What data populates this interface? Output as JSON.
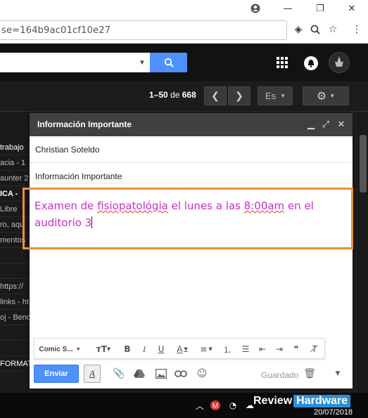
{
  "browser": {
    "url_fragment": "se=164b9ac01cf10e27"
  },
  "toolbar": {
    "page_range": "1–50",
    "page_of": "de",
    "page_total": "668",
    "lang_label": "Es"
  },
  "message_list": [
    {
      "text": "trabajo",
      "style": "bright"
    },
    {
      "text": "acia - 1",
      "style": "normal"
    },
    {
      "text": "aunter 2",
      "style": "normal"
    },
    {
      "text": "ICA - ",
      "style": "bold"
    },
    {
      "text": "Libre",
      "style": "normal"
    },
    {
      "text": "ro, aqu",
      "style": "normal"
    },
    {
      "text": "mentos",
      "style": "normal"
    },
    {
      "text": "",
      "style": "normal"
    },
    {
      "text": "",
      "style": "normal"
    },
    {
      "text": "https://",
      "style": "normal"
    },
    {
      "text": "links - ht",
      "style": "normal"
    },
    {
      "text": "oj - Bend",
      "style": "normal"
    },
    {
      "text": "",
      "style": "normal"
    },
    {
      "text": "",
      "style": "normal"
    },
    {
      "text": "FORMAT",
      "style": "bright"
    }
  ],
  "compose": {
    "title": "Información Importante",
    "to": "Christian Soteldo",
    "subject": "Información Importante",
    "body_line1": "Examen de",
    "body_line1_spell": "fisiopatológia",
    "body_line1_rest": "el lunes a las",
    "body_line1_time": "8:00am",
    "body_line1_end": "en el",
    "body_line2": "auditorio 3",
    "font_name": "Comic S...",
    "send_label": "Enviar",
    "saved_label": "Guardado",
    "body_color": "#cc2ccc",
    "highlight_color": "#e9913d"
  },
  "taskbar": {
    "date": "20/07/2018"
  },
  "watermark": {
    "left": "Review",
    "right": "Hardware"
  }
}
